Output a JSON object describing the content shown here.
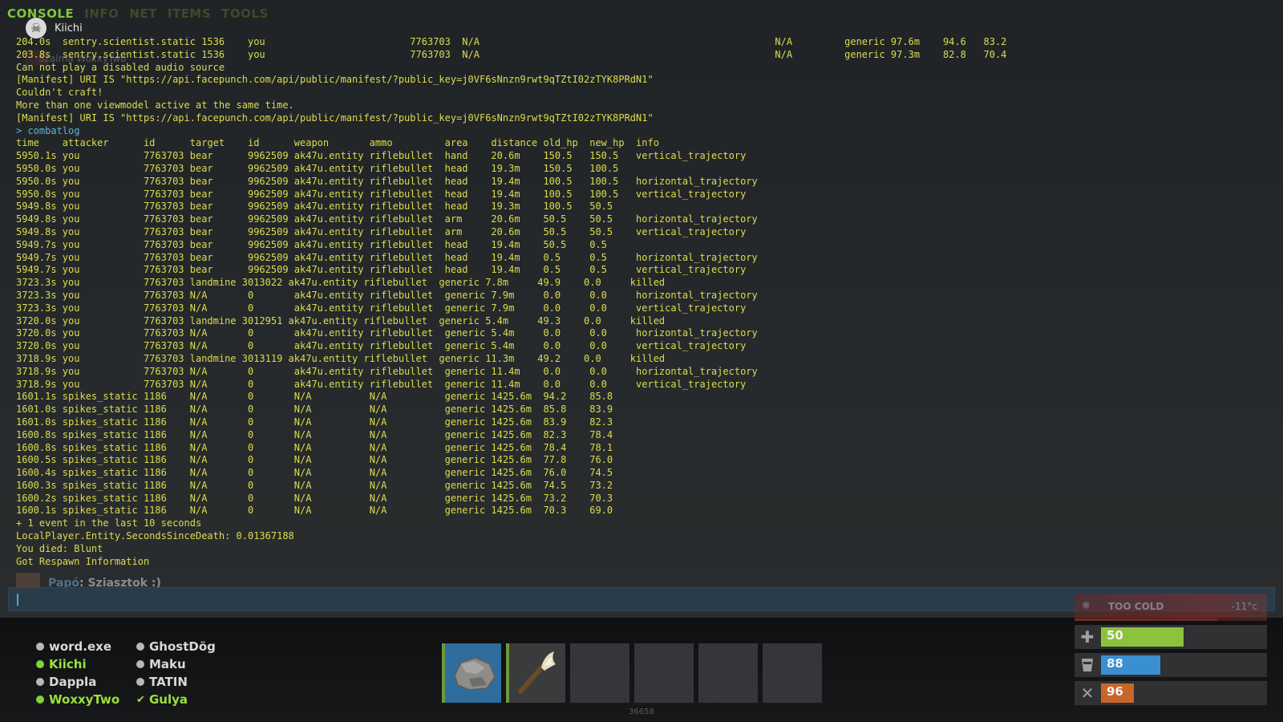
{
  "tabs": [
    "CONSOLE",
    "INFO",
    "NET",
    "ITEMS",
    "TOOLS"
  ],
  "active_tab": "CONSOLE",
  "voice": {
    "speaker": "Kiichi",
    "faded": "Szalma WoxxyTwo"
  },
  "log_top": [
    "204.0s  sentry.scientist.static 1536    you                         7763703  N/A                                                   N/A         generic 97.6m    94.6   83.2",
    "203.8s  sentry.scientist.static 1536    you                         7763703  N/A                                                   N/A         generic 97.3m    82.8   70.4",
    "Can not play a disabled audio source",
    "[Manifest] URI IS \"https://api.facepunch.com/api/public/manifest/?public_key=j0VF6sNnzn9rwt9qTZtI02zTYK8PRdN1\"",
    "Couldn't craft!",
    "More than one viewmodel active at the same time.",
    "[Manifest] URI IS \"https://api.facepunch.com/api/public/manifest/?public_key=j0VF6sNnzn9rwt9qTZtI02zTYK8PRdN1\""
  ],
  "command": "> combatlog",
  "combatlog": [
    "time    attacker      id      target    id      weapon       ammo         area    distance old_hp  new_hp  info",
    "5950.1s you           7763703 bear      9962509 ak47u.entity riflebullet  hand    20.6m    150.5   150.5   vertical_trajectory",
    "5950.0s you           7763703 bear      9962509 ak47u.entity riflebullet  head    19.3m    150.5   100.5",
    "5950.0s you           7763703 bear      9962509 ak47u.entity riflebullet  head    19.4m    100.5   100.5   horizontal_trajectory",
    "5950.0s you           7763703 bear      9962509 ak47u.entity riflebullet  head    19.4m    100.5   100.5   vertical_trajectory",
    "5949.8s you           7763703 bear      9962509 ak47u.entity riflebullet  head    19.3m    100.5   50.5",
    "5949.8s you           7763703 bear      9962509 ak47u.entity riflebullet  arm     20.6m    50.5    50.5    horizontal_trajectory",
    "5949.8s you           7763703 bear      9962509 ak47u.entity riflebullet  arm     20.6m    50.5    50.5    vertical_trajectory",
    "5949.7s you           7763703 bear      9962509 ak47u.entity riflebullet  head    19.4m    50.5    0.5",
    "5949.7s you           7763703 bear      9962509 ak47u.entity riflebullet  head    19.4m    0.5     0.5     horizontal_trajectory",
    "5949.7s you           7763703 bear      9962509 ak47u.entity riflebullet  head    19.4m    0.5     0.5     vertical_trajectory",
    "3723.3s you           7763703 landmine 3013022 ak47u.entity riflebullet  generic 7.8m     49.9    0.0     killed",
    "3723.3s you           7763703 N/A       0       ak47u.entity riflebullet  generic 7.9m     0.0     0.0     horizontal_trajectory",
    "3723.3s you           7763703 N/A       0       ak47u.entity riflebullet  generic 7.9m     0.0     0.0     vertical_trajectory",
    "3720.0s you           7763703 landmine 3012951 ak47u.entity riflebullet  generic 5.4m     49.3    0.0     killed",
    "3720.0s you           7763703 N/A       0       ak47u.entity riflebullet  generic 5.4m     0.0     0.0     horizontal_trajectory",
    "3720.0s you           7763703 N/A       0       ak47u.entity riflebullet  generic 5.4m     0.0     0.0     vertical_trajectory",
    "3718.9s you           7763703 landmine 3013119 ak47u.entity riflebullet  generic 11.3m    49.2    0.0     killed",
    "3718.9s you           7763703 N/A       0       ak47u.entity riflebullet  generic 11.4m    0.0     0.0     horizontal_trajectory",
    "3718.9s you           7763703 N/A       0       ak47u.entity riflebullet  generic 11.4m    0.0     0.0     vertical_trajectory",
    "1601.1s spikes_static 1186    N/A       0       N/A          N/A          generic 1425.6m  94.2    85.8",
    "1601.0s spikes_static 1186    N/A       0       N/A          N/A          generic 1425.6m  85.8    83.9",
    "1601.0s spikes_static 1186    N/A       0       N/A          N/A          generic 1425.6m  83.9    82.3",
    "1600.8s spikes_static 1186    N/A       0       N/A          N/A          generic 1425.6m  82.3    78.4",
    "1600.8s spikes_static 1186    N/A       0       N/A          N/A          generic 1425.6m  78.4    78.1",
    "1600.5s spikes_static 1186    N/A       0       N/A          N/A          generic 1425.6m  77.8    76.0",
    "1600.4s spikes_static 1186    N/A       0       N/A          N/A          generic 1425.6m  76.0    74.5",
    "1600.3s spikes_static 1186    N/A       0       N/A          N/A          generic 1425.6m  74.5    73.2",
    "1600.2s spikes_static 1186    N/A       0       N/A          N/A          generic 1425.6m  73.2    70.3",
    "1600.1s spikes_static 1186    N/A       0       N/A          N/A          generic 1425.6m  70.3    69.0"
  ],
  "log_bottom": [
    "+ 1 event in the last 10 seconds",
    "LocalPlayer.Entity.SecondsSinceDeath: 0.01367188",
    "You died: Blunt",
    "Got Respawn Information"
  ],
  "chat": {
    "name": "Papó",
    "message": ": Sziasztok :)"
  },
  "team_left": [
    {
      "name": "word.exe",
      "status": "offline"
    },
    {
      "name": "Kiichi",
      "status": "online"
    },
    {
      "name": "Dappla",
      "status": "offline"
    },
    {
      "name": "WoxxyTwo",
      "status": "online"
    }
  ],
  "team_right": [
    {
      "name": "GhostDög",
      "status": "offline"
    },
    {
      "name": "Maku",
      "status": "offline"
    },
    {
      "name": "TATIN",
      "status": "offline"
    },
    {
      "name": "Gulya",
      "status": "leader"
    }
  ],
  "hotbar": [
    {
      "item": "rock-icon",
      "selected": true
    },
    {
      "item": "torch-icon",
      "selected": false
    },
    {
      "item": "",
      "selected": false
    },
    {
      "item": "",
      "selected": false
    },
    {
      "item": "",
      "selected": false
    },
    {
      "item": "",
      "selected": false
    }
  ],
  "grid_readout": "36658",
  "status": {
    "cold": {
      "label": "TOO COLD",
      "temp": "-11°c"
    },
    "health": {
      "value": "50",
      "fraction": 0.5,
      "color": "#8cc33c"
    },
    "hydration": {
      "value": "88",
      "fraction": 0.36,
      "color": "#3a8fd0"
    },
    "food": {
      "value": "96",
      "fraction": 0.2,
      "color": "#c8662a"
    }
  }
}
